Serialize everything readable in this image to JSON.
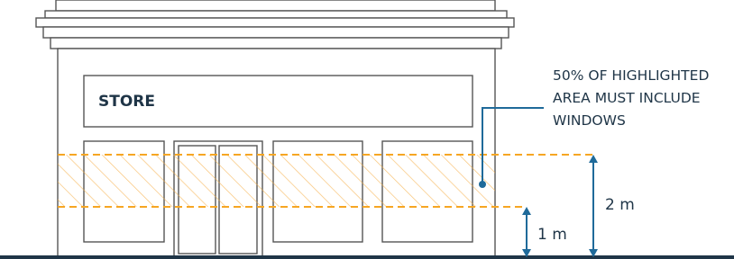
{
  "sign_text": "STORE",
  "annotation": {
    "lines": [
      "50% OF HIGHLIGHTED",
      "AREA MUST INCLUDE",
      "WINDOWS"
    ],
    "color": "#1f6a9a"
  },
  "dimensions": {
    "upper": "2 m",
    "lower": "1 m"
  },
  "colors": {
    "outline": "#555555",
    "highlight": "#f6a623",
    "ground": "#1f3547"
  }
}
